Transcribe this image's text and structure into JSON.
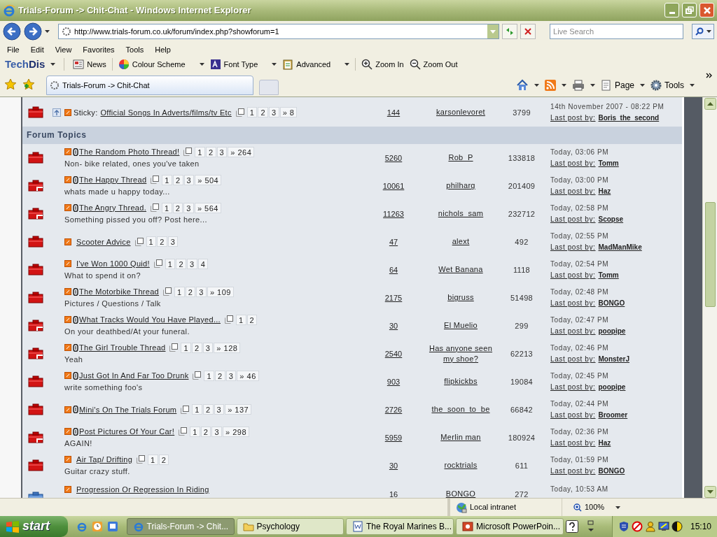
{
  "window": {
    "title": "Trials-Forum -> Chit-Chat - Windows Internet Explorer"
  },
  "address": {
    "url": "http://www.trials-forum.co.uk/forum/index.php?showforum=1"
  },
  "search": {
    "placeholder": "Live Search"
  },
  "menu": [
    "File",
    "Edit",
    "View",
    "Favorites",
    "Tools",
    "Help"
  ],
  "techdis": {
    "brand_a": "Tech",
    "brand_b": "Dis",
    "items": [
      {
        "kind": "news",
        "label": "News",
        "dropdown": false
      },
      {
        "kind": "colour",
        "label": "Colour Scheme",
        "dropdown": true
      },
      {
        "kind": "font",
        "label": "Font Type",
        "dropdown": true
      },
      {
        "kind": "advanced",
        "label": "Advanced",
        "dropdown": true
      },
      {
        "kind": "zoomin",
        "label": "Zoom In",
        "dropdown": false
      },
      {
        "kind": "zoomout",
        "label": "Zoom Out",
        "dropdown": false
      }
    ]
  },
  "tab": {
    "label": "Trials-Forum -> Chit-Chat"
  },
  "command_bar": [
    "Page",
    "Tools"
  ],
  "sticky_rows": [
    {
      "kind": "hot",
      "prefix": "Sticky:",
      "attachment": false,
      "title": "Official Songs In Adverts/films/tv Etc",
      "pages": [
        "1",
        "2",
        "3"
      ],
      "last_page": "» 8",
      "replies": "144",
      "starter": "karsonlevoret",
      "views": "3799",
      "date": "14th November 2007 - 08:22 PM",
      "last_label": "Last post by:",
      "last_by": "Boris_the_second"
    }
  ],
  "section_title": "Forum Topics",
  "topic_rows": [
    {
      "kind": "hot",
      "attachment": true,
      "title": "The Random Photo Thread!",
      "desc": "Non- bike related, ones you've taken",
      "pages": [
        "1",
        "2",
        "3"
      ],
      "last_page": "» 264",
      "replies": "5260",
      "starter": "Rob_P",
      "views": "133818",
      "date": "Today, 03:06 PM",
      "last_label": "Last post by:",
      "last_by": "Tomm"
    },
    {
      "kind": "hot_posted",
      "attachment": true,
      "title": "The Happy Thread",
      "desc": "whats made u happy today...",
      "pages": [
        "1",
        "2",
        "3"
      ],
      "last_page": "» 504",
      "replies": "10061",
      "starter": "philharg",
      "views": "201409",
      "date": "Today, 03:00 PM",
      "last_label": "Last post by:",
      "last_by": "Haz"
    },
    {
      "kind": "hot_posted",
      "attachment": true,
      "title": "The Angry Thread.",
      "desc": "Something pissed you off? Post here...",
      "pages": [
        "1",
        "2",
        "3"
      ],
      "last_page": "» 564",
      "replies": "11263",
      "starter": "nichols_sam",
      "views": "232712",
      "date": "Today, 02:58 PM",
      "last_label": "Last post by:",
      "last_by": "Scopse"
    },
    {
      "kind": "hot",
      "attachment": false,
      "title": "Scooter Advice",
      "pages": [
        "1",
        "2",
        "3"
      ],
      "replies": "47",
      "starter": "alext",
      "views": "492",
      "date": "Today, 02:55 PM",
      "last_label": "Last post by:",
      "last_by": "MadManMike"
    },
    {
      "kind": "hot",
      "attachment": false,
      "title": "I've Won 1000 Quid!",
      "desc": "What to spend it on?",
      "pages": [
        "1",
        "2",
        "3",
        "4"
      ],
      "replies": "64",
      "starter": "Wet Banana",
      "views": "1118",
      "date": "Today, 02:54 PM",
      "last_label": "Last post by:",
      "last_by": "Tomm"
    },
    {
      "kind": "hot",
      "attachment": true,
      "title": "The Motorbike Thread",
      "desc": "Pictures / Questions / Talk",
      "pages": [
        "1",
        "2",
        "3"
      ],
      "last_page": "» 109",
      "replies": "2175",
      "starter": "bigruss",
      "views": "51498",
      "date": "Today, 02:48 PM",
      "last_label": "Last post by:",
      "last_by": "BONGO"
    },
    {
      "kind": "hot_posted",
      "attachment": true,
      "title": "What Tracks Would You Have Played...",
      "desc": "On your deathbed/At your funeral.",
      "pages": [
        "1",
        "2"
      ],
      "replies": "30",
      "starter": "El Muelio",
      "views": "299",
      "date": "Today, 02:47 PM",
      "last_label": "Last post by:",
      "last_by": "poopipe"
    },
    {
      "kind": "hot_posted",
      "attachment": true,
      "title": "The Girl Trouble Thread",
      "desc": "Yeah",
      "pages": [
        "1",
        "2",
        "3"
      ],
      "last_page": "» 128",
      "replies": "2540",
      "starter": "Has anyone seen my shoe?",
      "views": "62213",
      "date": "Today, 02:46 PM",
      "last_label": "Last post by:",
      "last_by": "MonsterJ"
    },
    {
      "kind": "hot",
      "attachment": true,
      "title": "Just Got In And Far Too Drunk",
      "desc": "write something foo's",
      "pages": [
        "1",
        "2",
        "3"
      ],
      "last_page": "» 46",
      "replies": "903",
      "starter": "flipkickbs",
      "views": "19084",
      "date": "Today, 02:45 PM",
      "last_label": "Last post by:",
      "last_by": "poopipe"
    },
    {
      "kind": "hot",
      "attachment": true,
      "title": "Mini's On The Trials Forum",
      "pages": [
        "1",
        "2",
        "3"
      ],
      "last_page": "» 137",
      "replies": "2726",
      "starter": "the_soon_to_be",
      "views": "66842",
      "date": "Today, 02:44 PM",
      "last_label": "Last post by:",
      "last_by": "Broomer"
    },
    {
      "kind": "hot_posted",
      "attachment": true,
      "title": "Post Pictures Of Your Car!",
      "desc": "AGAIN!",
      "pages": [
        "1",
        "2",
        "3"
      ],
      "last_page": "» 298",
      "replies": "5959",
      "starter": "Merlin man",
      "views": "180924",
      "date": "Today, 02:36 PM",
      "last_label": "Last post by:",
      "last_by": "Haz"
    },
    {
      "kind": "hot",
      "attachment": false,
      "title": "Air Tap/ Drifting",
      "desc": "Guitar crazy stuff.",
      "pages": [
        "1",
        "2"
      ],
      "replies": "30",
      "starter": "rocktrials",
      "views": "611",
      "date": "Today, 01:59 PM",
      "last_label": "Last post by:",
      "last_by": "BONGO"
    },
    {
      "kind": "normal",
      "attachment": false,
      "title": "Progression Or Regression In Riding",
      "replies": "16",
      "starter": "BONGO",
      "views": "272",
      "date": "Today, 10:53 AM"
    }
  ],
  "status_bar": {
    "zone": "Local intranet",
    "zoom": "100%"
  },
  "taskbar": {
    "start": "start",
    "tasks": [
      {
        "kind": "ie",
        "label": "Trials-Forum -> Chit...",
        "selected": true
      },
      {
        "kind": "folder",
        "label": "Psychology",
        "selected": false
      },
      {
        "kind": "word",
        "label": "The Royal Marines B...",
        "selected": false
      },
      {
        "kind": "ppt",
        "label": "Microsoft PowerPoin...",
        "selected": false
      }
    ],
    "clock": "15:10"
  }
}
